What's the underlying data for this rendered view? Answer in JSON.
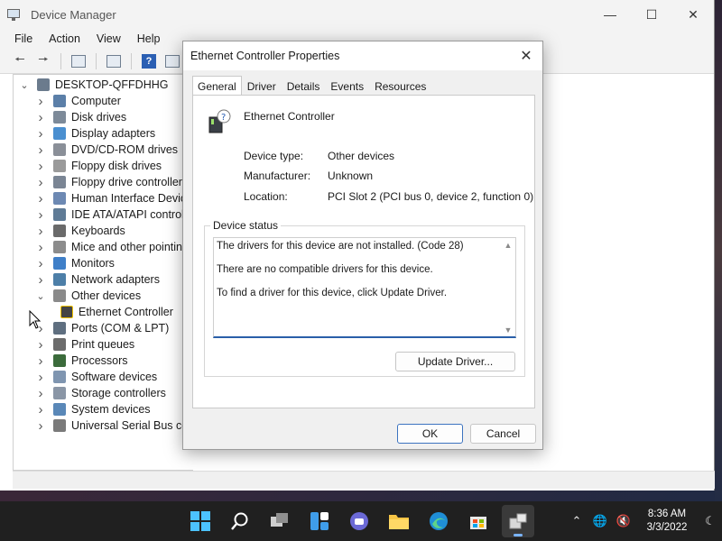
{
  "main_window": {
    "title": "Device Manager",
    "menu": [
      "File",
      "Action",
      "View",
      "Help"
    ],
    "tree": {
      "root": "DESKTOP-QFFDHHG",
      "items": [
        {
          "label": "Computer",
          "expanded": false
        },
        {
          "label": "Disk drives",
          "expanded": false
        },
        {
          "label": "Display adapters",
          "expanded": false
        },
        {
          "label": "DVD/CD-ROM drives",
          "expanded": false
        },
        {
          "label": "Floppy disk drives",
          "expanded": false
        },
        {
          "label": "Floppy drive controllers",
          "expanded": false
        },
        {
          "label": "Human Interface Device",
          "expanded": false
        },
        {
          "label": "IDE ATA/ATAPI controlle",
          "expanded": false
        },
        {
          "label": "Keyboards",
          "expanded": false
        },
        {
          "label": "Mice and other pointing",
          "expanded": false
        },
        {
          "label": "Monitors",
          "expanded": false
        },
        {
          "label": "Network adapters",
          "expanded": false
        },
        {
          "label": "Other devices",
          "expanded": true
        },
        {
          "label": "Ethernet Controller",
          "child": true
        },
        {
          "label": "Ports (COM & LPT)",
          "expanded": false
        },
        {
          "label": "Print queues",
          "expanded": false
        },
        {
          "label": "Processors",
          "expanded": false
        },
        {
          "label": "Software devices",
          "expanded": false
        },
        {
          "label": "Storage controllers",
          "expanded": false
        },
        {
          "label": "System devices",
          "expanded": false
        },
        {
          "label": "Universal Serial Bus con",
          "expanded": false
        }
      ]
    }
  },
  "dialog": {
    "title": "Ethernet Controller Properties",
    "tabs": [
      "General",
      "Driver",
      "Details",
      "Events",
      "Resources"
    ],
    "active_tab": "General",
    "device_name": "Ethernet Controller",
    "properties": [
      {
        "label": "Device type:",
        "value": "Other devices"
      },
      {
        "label": "Manufacturer:",
        "value": "Unknown"
      },
      {
        "label": "Location:",
        "value": "PCI Slot 2 (PCI bus 0, device 2, function 0)"
      }
    ],
    "status_group_label": "Device status",
    "status_lines": [
      "The drivers for this device are not installed. (Code 28)",
      "There are no compatible drivers for this device.",
      "To find a driver for this device, click Update Driver."
    ],
    "update_driver_label": "Update Driver...",
    "ok_label": "OK",
    "cancel_label": "Cancel"
  },
  "taskbar": {
    "time": "8:36 AM",
    "date": "3/3/2022"
  }
}
